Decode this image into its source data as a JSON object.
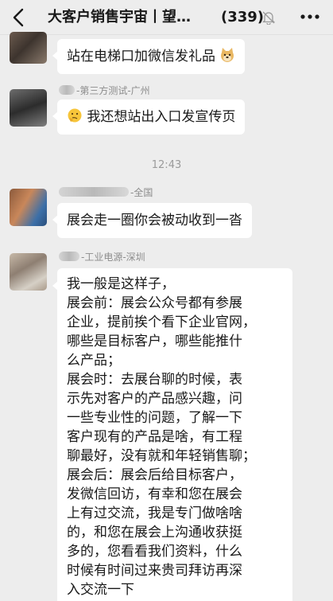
{
  "header": {
    "title": "大客户销售宇宙丨望…",
    "count": "(339)"
  },
  "messages": [
    {
      "sender": "",
      "text": "站在电梯口加微信发礼品"
    },
    {
      "sender": "-第三方测试-广州",
      "text": "我还想站出入口发宣传页"
    },
    {
      "sender": "-全国",
      "text": "展会走一圈你会被动收到一沓"
    },
    {
      "sender": "-工业电源-深圳",
      "lines": [
        "我一般是这样子，",
        "展会前：展会公众号都有参展",
        "企业，提前挨个看下企业官网，",
        "哪些是目标客户，哪些能推什",
        "么产品；",
        "展会时：去展台聊的时候，表",
        "示先对客户的产品感兴趣，问",
        "一些专业性的问题，了解一下",
        "客户现有的产品是啥，有工程",
        "聊最好，没有就和年轻销售聊；",
        "展会后：展会后给目标客户，",
        "发微信回访，有幸和您在展会",
        "上有过交流，我是专门做啥啥",
        "的，和您在展会上沟通收获挺",
        "多的，您看看我们资料，什么",
        "时候有时间过来贵司拜访再深",
        "入交流一下"
      ]
    }
  ],
  "timestamp": "12:43",
  "icons": [
    "back-icon",
    "mute-bell-icon",
    "more-icon",
    "doge-emoji",
    "thinking-face-emoji"
  ]
}
